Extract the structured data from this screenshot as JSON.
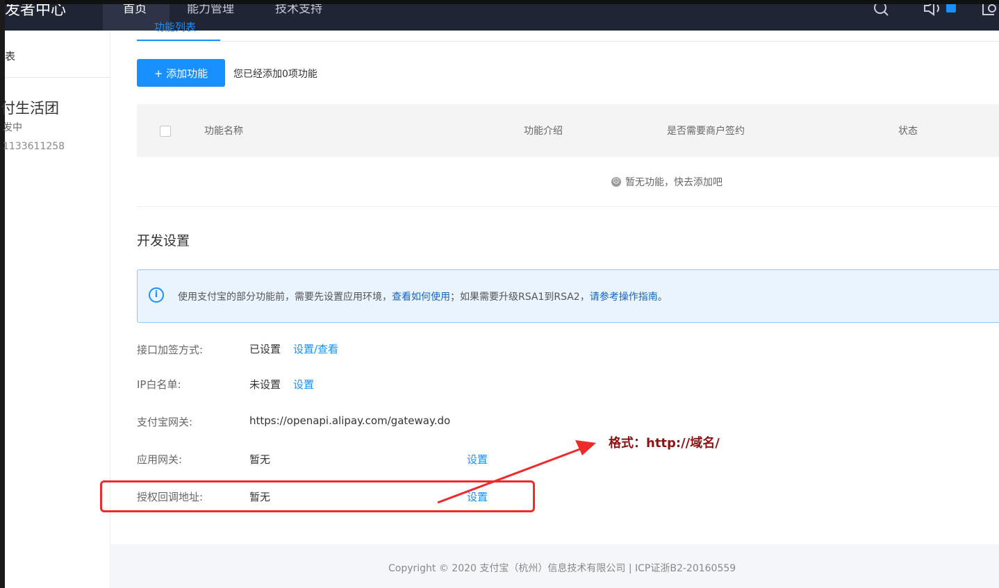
{
  "topbar": {
    "brand": "发者中心",
    "nav": [
      "首页",
      "能力管理",
      "技术支持"
    ]
  },
  "sidebar": {
    "item": "表",
    "app_name": "付生活团",
    "app_status": "发中",
    "app_id": "1133611258"
  },
  "tab": {
    "label": "功能列表"
  },
  "features": {
    "add_button": "+ 添加功能",
    "added_count": "您已经添加0项功能",
    "columns": [
      "功能名称",
      "功能介绍",
      "是否需要商户签约",
      "状态"
    ],
    "empty_message": "暂无功能，快去添加吧"
  },
  "dev_settings": {
    "title": "开发设置",
    "notice": {
      "text_1": "使用支付宝的部分功能前，需要先设置应用环境，",
      "link_1": "查看如何使用",
      "text_2": "；如果需要升级RSA1到RSA2，",
      "link_2": "请参考操作指南",
      "text_3": "。"
    },
    "rows": [
      {
        "label": "接口加签方式:",
        "value": "已设置",
        "link": "设置/查看"
      },
      {
        "label": "IP白名单:",
        "value": "未设置",
        "link": "设置"
      },
      {
        "label": "支付宝网关:",
        "value": "https://openapi.alipay.com/gateway.do"
      },
      {
        "label": "应用网关:",
        "value": "暂无",
        "link": "设置"
      },
      {
        "label": "授权回调地址:",
        "value": "暂无",
        "link": "设置"
      }
    ]
  },
  "annotation": {
    "text": "格式：http://域名/"
  },
  "footer": {
    "copyright": "Copyright © 2020 支付宝（杭州）信息技术有限公司 | ICP证浙B2-20160559"
  },
  "colors": {
    "accent": "#1890ff",
    "topbar": "#1f2535",
    "annotation_red": "#ee2a2a",
    "annotation_text": "#8b1414"
  }
}
